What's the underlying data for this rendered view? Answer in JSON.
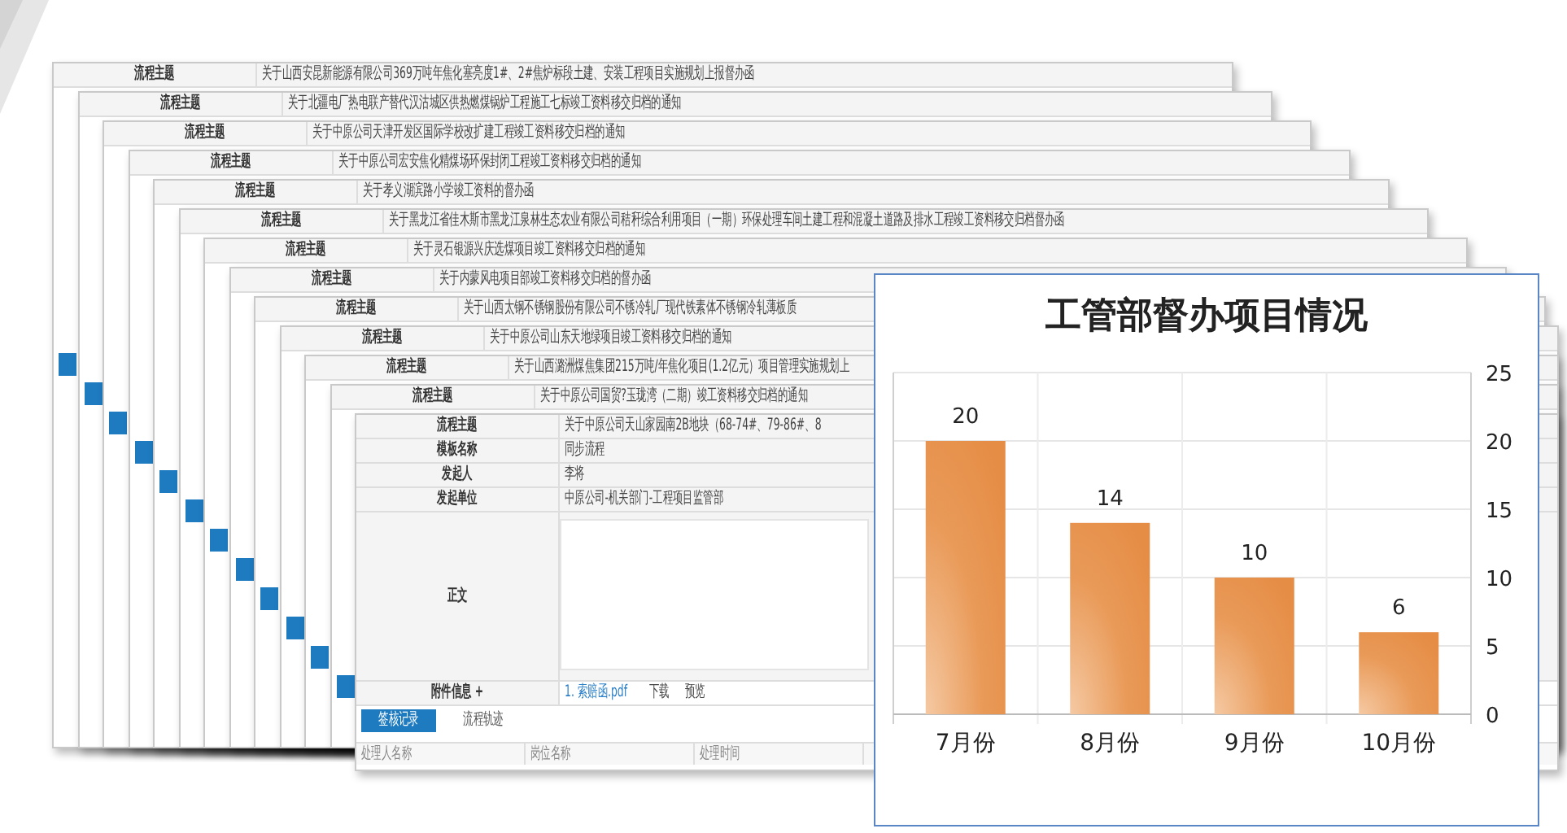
{
  "windows": [
    {
      "label": "流程主题",
      "title": "关于山西安昆新能源有限公司369万吨年焦化塞亮度1#、2#焦炉标段土建、安装工程项目实施规划上报督办函"
    },
    {
      "label": "流程主题",
      "title": "关于北疆电厂热电联产替代汉沽城区供热燃煤锅炉工程施工七标竣工资料移交归档的通知"
    },
    {
      "label": "流程主题",
      "title": "关于中原公司天津开发区国际学校改扩建工程竣工资料移交归档的通知"
    },
    {
      "label": "流程主题",
      "title": "关于中原公司宏安焦化精煤场环保封闭工程竣工资料移交归档的通知"
    },
    {
      "label": "流程主题",
      "title": "关于孝义湖滨路小学竣工资料的督办函"
    },
    {
      "label": "流程主题",
      "title": "关于黑龙江省佳木斯市黑龙江泉林生态农业有限公司秸秆综合利用项目（一期）环保处理车间土建工程和混凝土道路及排水工程竣工资料移交归档督办函"
    },
    {
      "label": "流程主题",
      "title": "关于灵石银源兴庆选煤项目竣工资料移交归档的通知"
    },
    {
      "label": "流程主题",
      "title": "关于内蒙风电项目部竣工资料移交归档的督办函"
    },
    {
      "label": "流程主题",
      "title": "关于山西太钢不锈钢股份有限公司不锈冷轧厂现代铁素体不锈钢冷轧薄板质"
    },
    {
      "label": "流程主题",
      "title": "关于中原公司山东天地绿项目竣工资料移交归档的通知"
    },
    {
      "label": "流程主题",
      "title": "关于山西潞洲煤焦集团215万吨/年焦化项目(1.2亿元）项目管理实施规划上"
    },
    {
      "label": "流程主题",
      "title": "关于中原公司国贸?玉珑湾（二期）竣工资料移交归档的通知"
    }
  ],
  "form": {
    "rows": [
      {
        "kind": "text",
        "label": "流程主题",
        "value": "关于中原公司天山家园南2B地块（68-74#、79-86#、8"
      },
      {
        "kind": "text",
        "label": "模板名称",
        "value": "同步流程"
      },
      {
        "kind": "text",
        "label": "发起人",
        "value": "李将"
      },
      {
        "kind": "text",
        "label": "发起单位",
        "value": "中原公司-机关部门-工程项目监管部"
      },
      {
        "kind": "editor",
        "label": "正文"
      },
      {
        "kind": "attachment",
        "label": "附件信息 +",
        "file": "1. 索赔函.pdf",
        "actions": [
          "下载",
          "预览"
        ]
      }
    ],
    "tabs": [
      {
        "label": "签核记录",
        "selected": true
      },
      {
        "label": "流程轨迹",
        "selected": false
      }
    ],
    "columns": [
      "处理人名称",
      "岗位名称",
      "处理时间"
    ]
  },
  "chart": {
    "chart_data": {
      "type": "bar",
      "title": "工管部督办项目情况",
      "categories": [
        "7月份",
        "8月份",
        "9月份",
        "10月份"
      ],
      "series": [
        {
          "color": "#e58c45",
          "values": [
            20,
            14,
            10,
            6
          ]
        }
      ],
      "ylim": [
        0,
        25
      ],
      "yticks": [
        0,
        5,
        10,
        15,
        20,
        25
      ],
      "grid": true,
      "data_labels": true
    }
  }
}
